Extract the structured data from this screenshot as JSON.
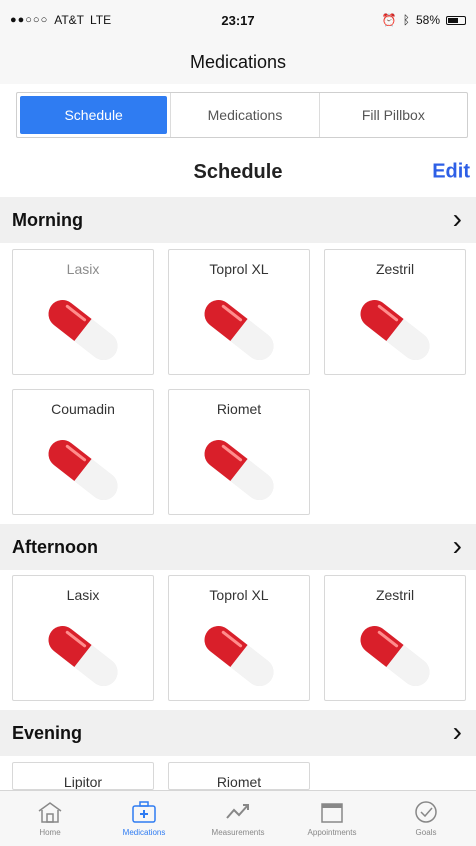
{
  "status": {
    "carrier": "AT&T",
    "network": "LTE",
    "time": "23:17",
    "battery": "58%"
  },
  "nav": {
    "title": "Medications"
  },
  "segments": [
    {
      "label": "Schedule",
      "active": true
    },
    {
      "label": "Medications",
      "active": false
    },
    {
      "label": "Fill Pillbox",
      "active": false
    }
  ],
  "schedule": {
    "title": "Schedule",
    "edit": "Edit"
  },
  "sections": [
    {
      "label": "Morning",
      "medications": [
        "Lasix",
        "Toprol XL",
        "Zestril",
        "Coumadin",
        "Riomet"
      ]
    },
    {
      "label": "Afternoon",
      "medications": [
        "Lasix",
        "Toprol XL",
        "Zestril"
      ]
    },
    {
      "label": "Evening",
      "medications": [
        "Lipitor",
        "Riomet"
      ]
    }
  ],
  "tabs": [
    {
      "label": "Home",
      "icon": "home-icon"
    },
    {
      "label": "Medications",
      "icon": "medical-bag-icon",
      "active": true
    },
    {
      "label": "Measurements",
      "icon": "trend-chart-icon"
    },
    {
      "label": "Appointments",
      "icon": "calendar-icon"
    },
    {
      "label": "Goals",
      "icon": "checkmark-circle-icon"
    }
  ],
  "colors": {
    "accent": "#2f7cf2",
    "edit": "#2d5fe6",
    "pill_red": "#d91f2a",
    "section_bg": "#f0f0f0"
  }
}
